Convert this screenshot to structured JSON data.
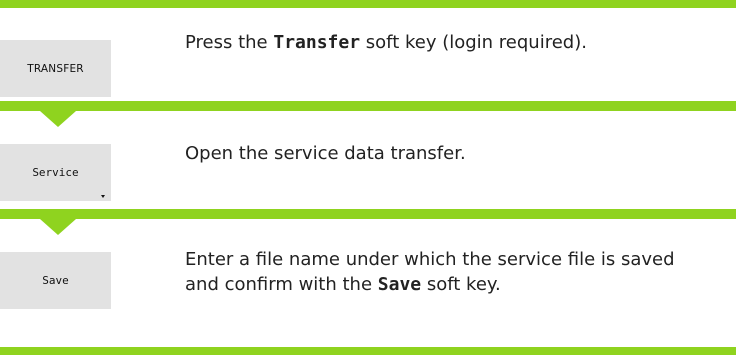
{
  "steps": [
    {
      "softkey_label": "TRANSFER",
      "text_before": "Press the ",
      "keyword": "Transfer",
      "text_after": " soft key (login required)."
    },
    {
      "softkey_label": "Service",
      "softkey_has_dropdown": true,
      "text": "Open the service data transfer."
    },
    {
      "softkey_label": "Save",
      "line1": "Enter a file name under which the service file is saved",
      "line2_before": "and confirm with the ",
      "keyword": "Save",
      "line2_after": " soft key."
    }
  ],
  "colors": {
    "accent_green": "#8fd31f",
    "softkey_bg": "#e2e2e2"
  }
}
